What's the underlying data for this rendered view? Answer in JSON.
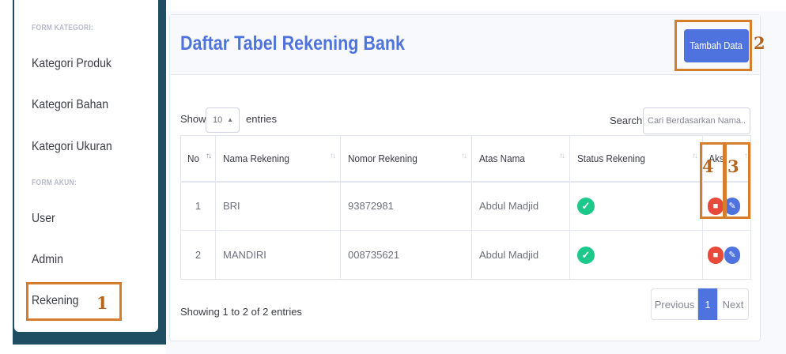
{
  "sidebar": {
    "section_kategori": "FORM KATEGORI:",
    "section_akun": "FORM AKUN:",
    "items": [
      {
        "label": "Kategori Produk"
      },
      {
        "label": "Kategori Bahan"
      },
      {
        "label": "Kategori Ukuran"
      },
      {
        "label": "User"
      },
      {
        "label": "Admin"
      },
      {
        "label": "Rekening"
      }
    ]
  },
  "header": {
    "title": "Daftar Tabel Rekening Bank",
    "add_button": "Tambah Data"
  },
  "controls": {
    "show_label": "Show",
    "entries_label": "entries",
    "page_length": "10",
    "search_label": "Search:",
    "search_placeholder": "Cari Berdasarkan Nama.."
  },
  "table": {
    "columns": [
      "No",
      "Nama Rekening",
      "Nomor Rekening",
      "Atas Nama",
      "Status Rekening",
      "Aksi"
    ],
    "rows": [
      {
        "no": "1",
        "nama": "BRI",
        "nomor": "93872981",
        "atas_nama": "Abdul Madjid",
        "status": "check-circle-icon"
      },
      {
        "no": "2",
        "nama": "MANDIRI",
        "nomor": "008735621",
        "atas_nama": "Abdul Madjid",
        "status": "check-circle-icon"
      }
    ]
  },
  "footer": {
    "info": "Showing 1 to 2 of 2 entries",
    "prev": "Previous",
    "page": "1",
    "next": "Next"
  },
  "annotations": [
    "1",
    "2",
    "3",
    "4"
  ],
  "colors": {
    "primary": "#4e73df",
    "success": "#1cc88a",
    "danger": "#e74a3b",
    "sidebar_dark": "#1f4e62",
    "annotation": "#d77e2c"
  }
}
